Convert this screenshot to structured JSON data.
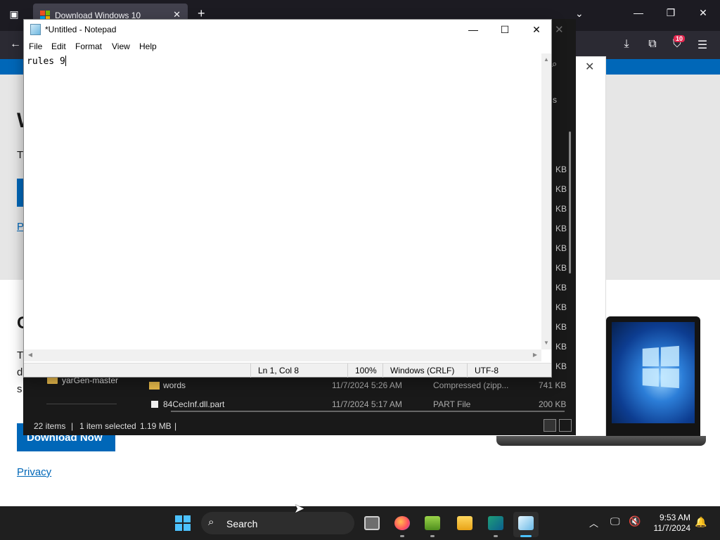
{
  "browser": {
    "tab_title": "Download Windows 10",
    "tab_close": "✕",
    "new_tab": "+",
    "extension_badge": "10"
  },
  "website": {
    "hero_heading": "W",
    "hero_paragraph": "T",
    "hero_link": "P",
    "section_heading": "C",
    "section_text_lines": [
      "T",
      "d",
      "s"
    ],
    "download_button": "Download Now",
    "privacy_link": "Privacy",
    "dialog_close": "✕"
  },
  "explorer": {
    "header_fragment": "s",
    "size_fragments": [
      "KB",
      "KB",
      "KB",
      "KB",
      "KB",
      "KB",
      "KB",
      "KB",
      "KB",
      "KB",
      "KB"
    ],
    "sidebar_item": "yarGen-master",
    "files": [
      {
        "name": "words",
        "date": "11/7/2024 5:26 AM",
        "type": "Compressed (zipp...",
        "size": "741 KB",
        "kind": "folder"
      },
      {
        "name": "84CecInf.dll.part",
        "date": "11/7/2024 5:17 AM",
        "type": "PART File",
        "size": "200 KB",
        "kind": "file"
      }
    ],
    "status": {
      "items": "22 items",
      "selected": "1 item selected",
      "size": "1.19 MB",
      "sep": "|"
    }
  },
  "notepad": {
    "title": "*Untitled - Notepad",
    "menu": [
      "File",
      "Edit",
      "Format",
      "View",
      "Help"
    ],
    "content": "rules 9",
    "status": {
      "position": "Ln 1, Col 8",
      "zoom": "100%",
      "line_ending": "Windows (CRLF)",
      "encoding": "UTF-8"
    }
  },
  "taskbar": {
    "search_placeholder": "Search",
    "time": "9:53 AM",
    "date": "11/7/2024",
    "apps": [
      "task-view",
      "firefox",
      "notepad-plus-plus",
      "file-explorer",
      "text-editor",
      "notepad"
    ]
  },
  "colors": {
    "accent": "#0067b8",
    "taskbar_accent": "#4cc2ff"
  }
}
